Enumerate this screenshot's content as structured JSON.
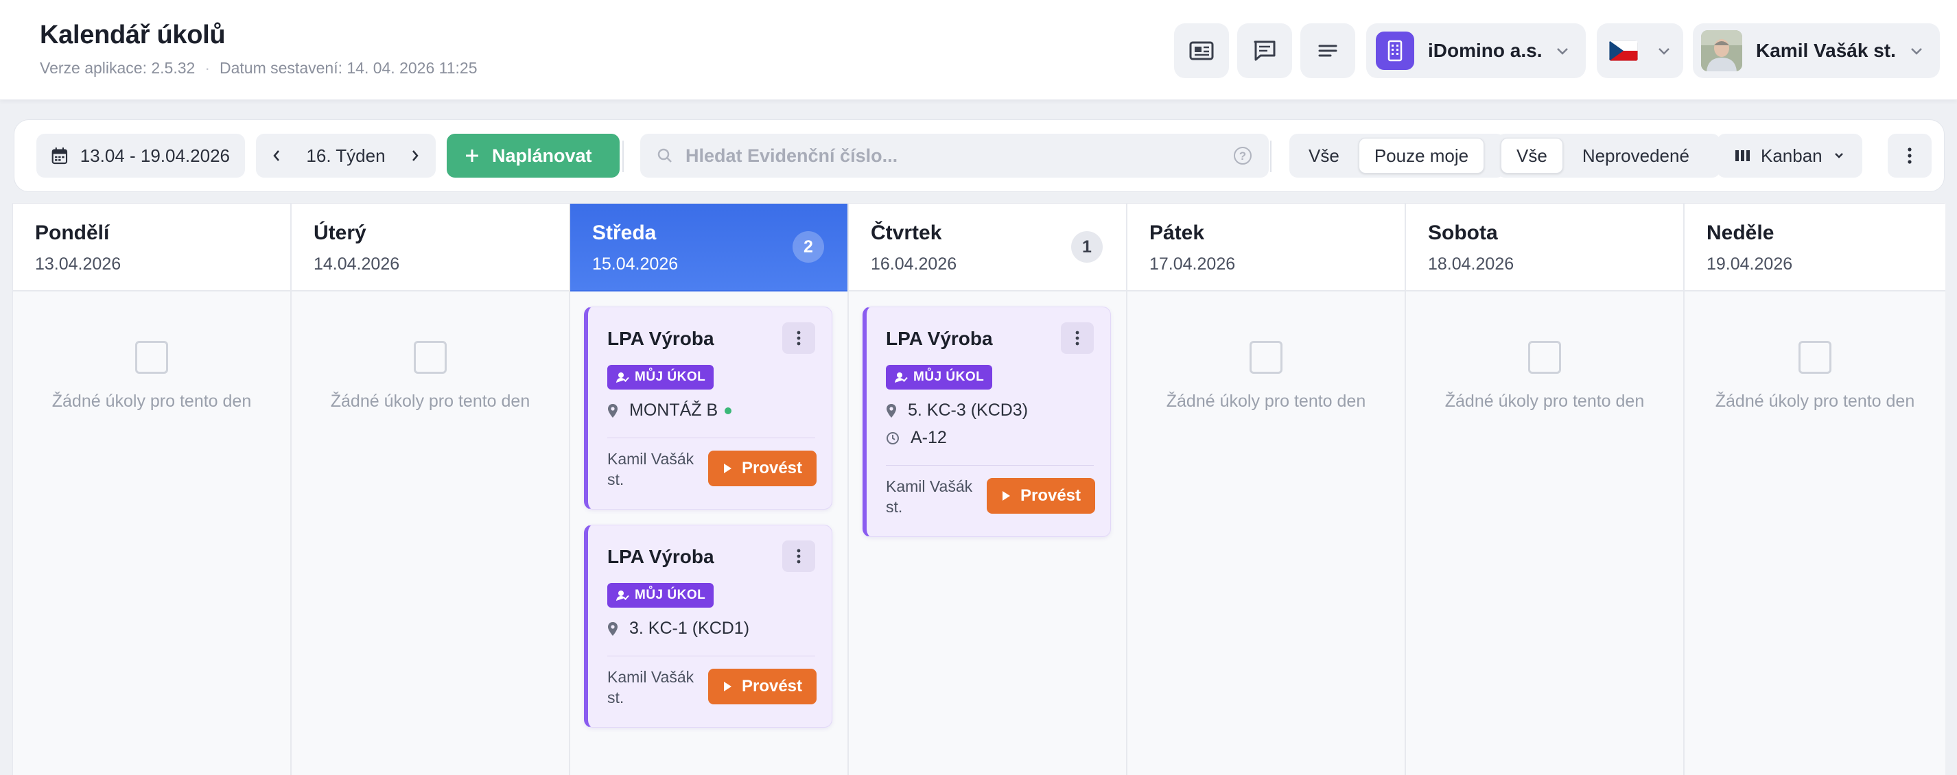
{
  "header": {
    "title": "Kalendář úkolů",
    "version": "Verze aplikace: 2.5.32",
    "build": "Datum sestavení: 14. 04. 2026 11:25",
    "icons": [
      "news-icon",
      "chat-icon",
      "menu-lines-icon"
    ],
    "company": "iDomino a.s.",
    "language_flag": "cz-flag",
    "user": "Kamil Vašák st."
  },
  "toolbar": {
    "date_range": "13.04 - 19.04.2026",
    "week": "16. Týden",
    "plan_label": "Naplánovat",
    "search_placeholder": "Hledat Evidenční číslo...",
    "filter_owner": [
      "Vše",
      "Pouze moje"
    ],
    "filter_owner_active": "Pouze moje",
    "filter_status": [
      "Vše",
      "Neprovedené"
    ],
    "filter_status_active": "Vše",
    "view": "Kanban"
  },
  "colors": {
    "accent_blue": "#3b6ee8",
    "plan_green": "#43b27f",
    "task_purple": "#7a3fe4",
    "run_orange": "#e86f2a"
  },
  "days": [
    {
      "name": "Pondělí",
      "date": "13.04.2026",
      "count": "",
      "empty": "Žádné úkoly pro tento den"
    },
    {
      "name": "Úterý",
      "date": "14.04.2026",
      "count": "",
      "empty": "Žádné úkoly pro tento den"
    },
    {
      "name": "Středa",
      "date": "15.04.2026",
      "count": "2",
      "today": true
    },
    {
      "name": "Čtvrtek",
      "date": "16.04.2026",
      "count": "1"
    },
    {
      "name": "Pátek",
      "date": "17.04.2026",
      "count": "",
      "empty": "Žádné úkoly pro tento den"
    },
    {
      "name": "Sobota",
      "date": "18.04.2026",
      "count": "",
      "empty": "Žádné úkoly pro tento den"
    },
    {
      "name": "Neděle",
      "date": "19.04.2026",
      "count": "",
      "empty": "Žádné úkoly pro tento den"
    }
  ],
  "tasks": {
    "wed_1": {
      "title": "LPA Výroba",
      "badge": "MŮJ ÚKOL",
      "location": "MONTÁŽ B",
      "assignee": "Kamil Vašák st.",
      "action": "Provést"
    },
    "wed_2": {
      "title": "LPA Výroba",
      "badge": "MŮJ ÚKOL",
      "location": "3. KC-1 (KCD1)",
      "assignee": "Kamil Vašák st.",
      "action": "Provést"
    },
    "thu_1": {
      "title": "LPA Výroba",
      "badge": "MŮJ ÚKOL",
      "location": "5. KC-3 (KCD3)",
      "time": "A-12",
      "assignee": "Kamil Vašák st.",
      "action": "Provést"
    }
  }
}
